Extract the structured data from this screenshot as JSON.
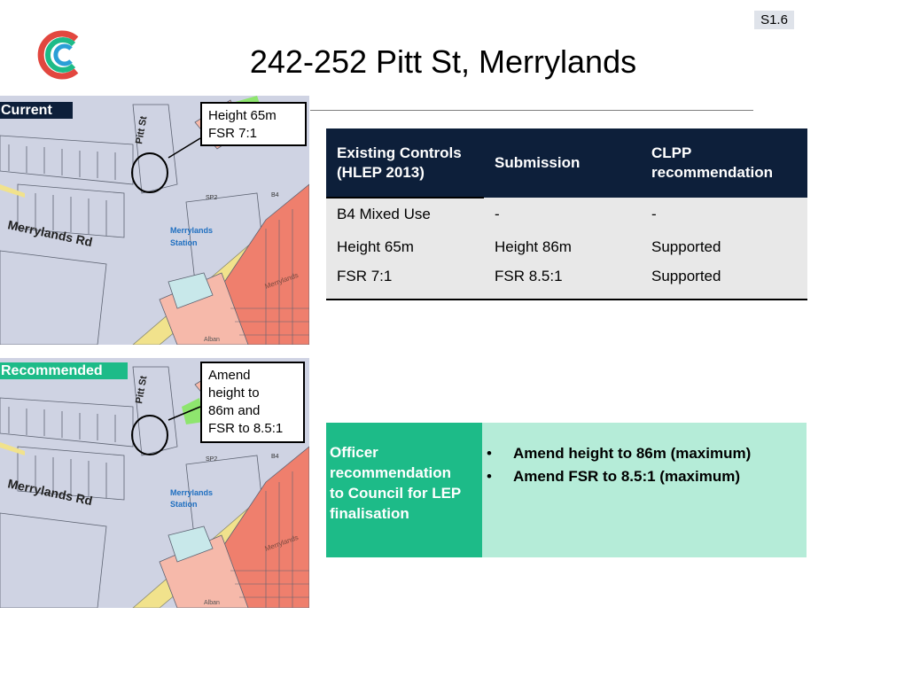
{
  "slide_id": "S1.6",
  "title": "242-252 Pitt St, Merrylands",
  "colors": {
    "navy": "#0d1f3a",
    "green": "#1dbb88",
    "light_green": "#b5ecd8",
    "grey": "#e8e8e8"
  },
  "maps": {
    "current": {
      "tag": "Current",
      "callout_lines": [
        "Height 65m",
        "FSR 7:1"
      ],
      "labels": {
        "street1": "Pitt St",
        "street2": "Merrylands Rd",
        "station1": "Merrylands",
        "station2": "Station",
        "sp2": "SP2",
        "b4": "B4",
        "merrylands": "Merrylands",
        "alban": "Alban"
      }
    },
    "recommended": {
      "tag": "Recommended",
      "callout_lines": [
        "Amend",
        "height to",
        "86m and",
        "FSR to 8.5:1"
      ],
      "labels": {
        "street1": "Pitt St",
        "street2": "Merrylands Rd",
        "station1": "Merrylands",
        "station2": "Station",
        "sp2": "SP2",
        "b4": "B4",
        "merrylands": "Merrylands",
        "alban": "Alban"
      }
    }
  },
  "controls_table": {
    "headers": [
      "Existing Controls",
      "(HLEP 2013)",
      "Submission",
      "CLPP",
      "recommendation"
    ],
    "rows": [
      [
        "B4 Mixed Use",
        "-",
        "-"
      ],
      [
        "Height 65m",
        "Height 86m",
        "Supported"
      ],
      [
        "FSR 7:1",
        "FSR 8.5:1",
        "Supported"
      ]
    ]
  },
  "officer": {
    "label_lines": [
      "Officer",
      "recommendation",
      "to Council for LEP",
      "finalisation"
    ],
    "bullet": "•",
    "items": [
      "Amend height to 86m (maximum)",
      "Amend FSR to 8.5:1  (maximum)"
    ]
  }
}
